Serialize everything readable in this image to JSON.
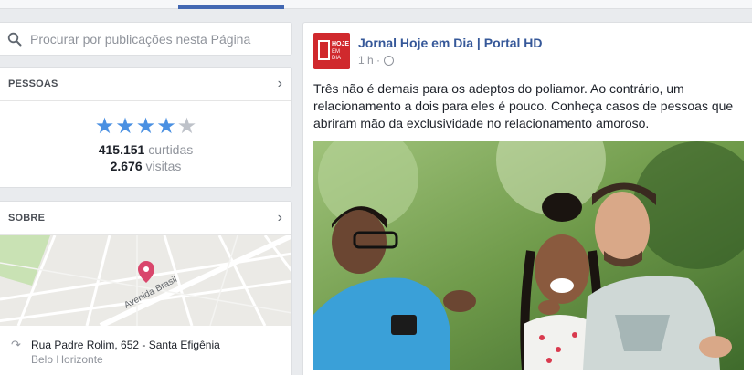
{
  "search": {
    "placeholder": "Procurar por publicações nesta Página"
  },
  "people_card": {
    "title": "PESSOAS",
    "rating": 4,
    "rating_max": 5,
    "likes_count": "415.151",
    "likes_label": "curtidas",
    "visits_count": "2.676",
    "visits_label": "visitas"
  },
  "about_card": {
    "title": "SOBRE",
    "map_street_label": "Avenida Brasil",
    "address_line1": "Rua Padre Rolim, 652 - Santa Efigênia",
    "address_line2": "Belo Horizonte"
  },
  "post": {
    "page_name": "Jornal Hoje em Dia | Portal HD",
    "logo_line1": "HOJE",
    "logo_line2": "EM DIA",
    "time": "1 h ·",
    "text": "Três não é demais para os adeptos do poliamor. Ao contrário, um relacionamento a dois para eles é pouco. Conheça casos de pessoas que abriram mão da exclusividade no relacionamento amoroso."
  },
  "colors": {
    "facebook_blue": "#4267b2",
    "link_blue": "#365899",
    "star_blue": "#4a90e2",
    "logo_red": "#d0292d",
    "map_pin": "#d9466c"
  }
}
